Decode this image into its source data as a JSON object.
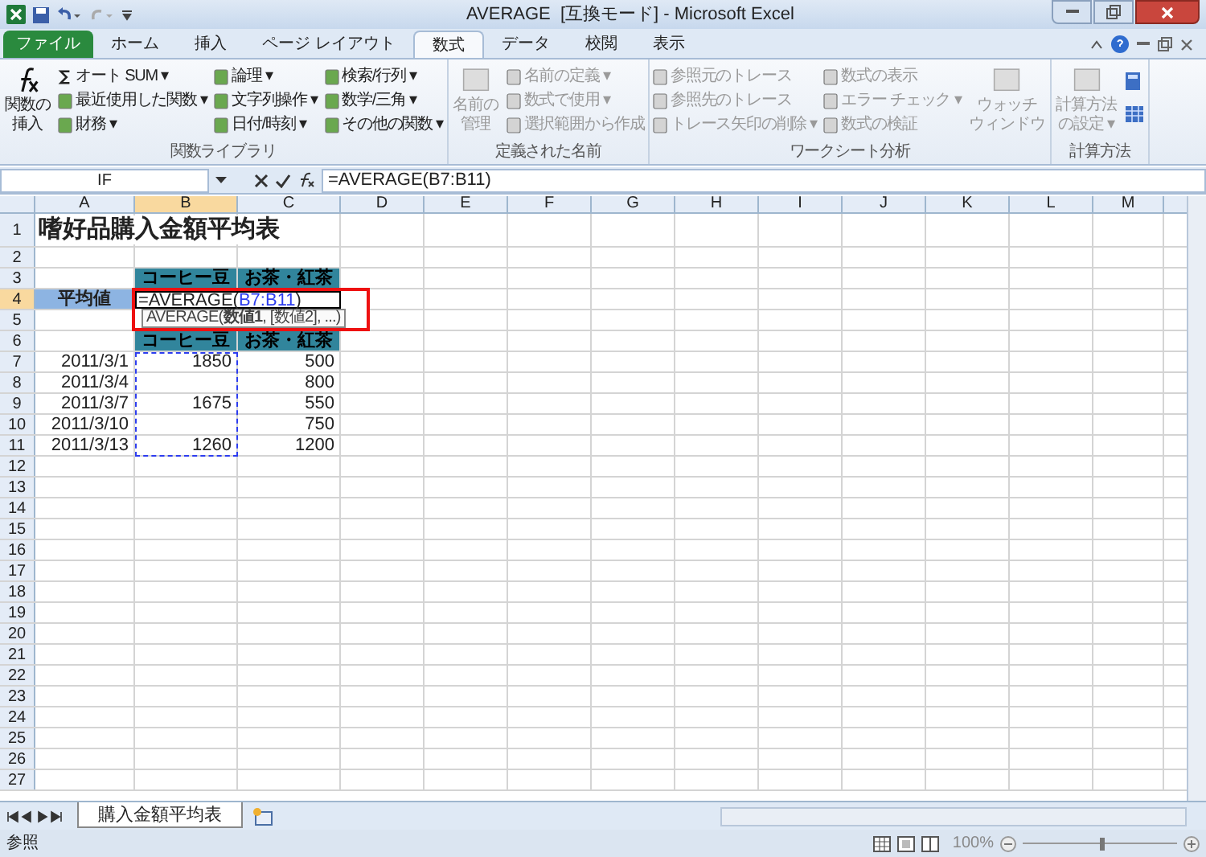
{
  "window": {
    "title": "AVERAGE  [互換モード] - Microsoft Excel"
  },
  "tabs": [
    {
      "label": "ファイル",
      "selected": false,
      "kind": "file"
    },
    {
      "label": "ホーム",
      "selected": false,
      "kind": "tab"
    },
    {
      "label": "挿入",
      "selected": false,
      "kind": "tab"
    },
    {
      "label": "ページ レイアウト",
      "selected": false,
      "kind": "tab"
    },
    {
      "label": "数式",
      "selected": true,
      "kind": "tab"
    },
    {
      "label": "データ",
      "selected": false,
      "kind": "tab"
    },
    {
      "label": "校閲",
      "selected": false,
      "kind": "tab"
    },
    {
      "label": "表示",
      "selected": false,
      "kind": "tab"
    }
  ],
  "ribbon": [
    {
      "label": "関数ライブラリ",
      "columns": [
        [
          {
            "lines": [
              "関数の",
              "挿入"
            ],
            "kind": "large",
            "disabled": false
          }
        ],
        [
          {
            "label": "オート SUM ▾",
            "kind": "sigma",
            "disabled": false
          },
          {
            "label": "最近使用した関数 ▾",
            "kind": "small",
            "disabled": false
          },
          {
            "label": "財務 ▾",
            "kind": "small",
            "disabled": false
          }
        ],
        [
          {
            "label": "論理 ▾",
            "kind": "small",
            "disabled": false
          },
          {
            "label": "文字列操作 ▾",
            "kind": "small",
            "disabled": false
          },
          {
            "label": "日付/時刻 ▾",
            "kind": "small",
            "disabled": false
          }
        ],
        [
          {
            "label": "検索/行列 ▾",
            "kind": "small",
            "disabled": false
          },
          {
            "label": "数学/三角 ▾",
            "kind": "small",
            "disabled": false
          },
          {
            "label": "その他の関数 ▾",
            "kind": "small",
            "disabled": false
          }
        ]
      ]
    },
    {
      "label": "定義された名前",
      "columns": [
        [
          {
            "lines": [
              "名前の",
              "管理"
            ],
            "kind": "large",
            "disabled": true
          }
        ],
        [
          {
            "label": "名前の定義 ▾",
            "kind": "small",
            "disabled": true
          },
          {
            "label": "数式で使用 ▾",
            "kind": "small",
            "disabled": true
          },
          {
            "label": "選択範囲から作成",
            "kind": "small",
            "disabled": true
          }
        ]
      ]
    },
    {
      "label": "ワークシート分析",
      "columns": [
        [
          {
            "label": "参照元のトレース",
            "kind": "small",
            "disabled": true
          },
          {
            "label": "参照先のトレース",
            "kind": "small",
            "disabled": true
          },
          {
            "label": "トレース矢印の削除 ▾",
            "kind": "small",
            "disabled": true
          }
        ],
        [
          {
            "label": "数式の表示",
            "kind": "small",
            "disabled": true
          },
          {
            "label": "エラー チェック ▾",
            "kind": "small",
            "disabled": true
          },
          {
            "label": "数式の検証",
            "kind": "small",
            "disabled": true
          }
        ],
        [
          {
            "lines": [
              "ウォッチ",
              "ウィンドウ"
            ],
            "kind": "large",
            "disabled": true
          }
        ]
      ]
    },
    {
      "label": "計算方法",
      "columns": [
        [
          {
            "lines": [
              "計算方法",
              "の設定 ▾"
            ],
            "kind": "large",
            "disabled": true
          }
        ],
        [
          {
            "kind": "iconpair"
          }
        ]
      ]
    }
  ],
  "formula_bar": {
    "name_box": "IF",
    "formula": "=AVERAGE(B7:B11)"
  },
  "columns": [
    {
      "label": "A",
      "selected": false
    },
    {
      "label": "B",
      "selected": true
    },
    {
      "label": "C",
      "selected": false
    },
    {
      "label": "D",
      "selected": false
    },
    {
      "label": "E",
      "selected": false
    },
    {
      "label": "F",
      "selected": false
    },
    {
      "label": "G",
      "selected": false
    },
    {
      "label": "H",
      "selected": false
    },
    {
      "label": "I",
      "selected": false
    },
    {
      "label": "J",
      "selected": false
    },
    {
      "label": "K",
      "selected": false
    },
    {
      "label": "L",
      "selected": false
    },
    {
      "label": "M",
      "selected": false
    }
  ],
  "rows": [
    {
      "header": "1",
      "selected": false,
      "cells": {
        "A": {
          "text": "嗜好品購入金額平均表",
          "kind": "title"
        }
      }
    },
    {
      "header": "2",
      "selected": false
    },
    {
      "header": "3",
      "selected": false,
      "cells": {
        "B": {
          "text": "コーヒー豆",
          "kind": "head"
        },
        "C": {
          "text": "お茶・紅茶",
          "kind": "head"
        }
      }
    },
    {
      "header": "4",
      "selected": true,
      "cells": {
        "A": {
          "text": "平均値",
          "kind": "label"
        }
      }
    },
    {
      "header": "5",
      "selected": false
    },
    {
      "header": "6",
      "selected": false,
      "cells": {
        "B": {
          "text": "コーヒー豆",
          "kind": "head"
        },
        "C": {
          "text": "お茶・紅茶",
          "kind": "head"
        }
      }
    },
    {
      "header": "7",
      "selected": false,
      "cells": {
        "A": {
          "text": "2011/3/1",
          "kind": "num"
        },
        "B": {
          "text": "1850",
          "kind": "num"
        },
        "C": {
          "text": "500",
          "kind": "num"
        }
      }
    },
    {
      "header": "8",
      "selected": false,
      "cells": {
        "A": {
          "text": "2011/3/4",
          "kind": "num"
        },
        "C": {
          "text": "800",
          "kind": "num"
        }
      }
    },
    {
      "header": "9",
      "selected": false,
      "cells": {
        "A": {
          "text": "2011/3/7",
          "kind": "num"
        },
        "B": {
          "text": "1675",
          "kind": "num"
        },
        "C": {
          "text": "550",
          "kind": "num"
        }
      }
    },
    {
      "header": "10",
      "selected": false,
      "cells": {
        "A": {
          "text": "2011/3/10",
          "kind": "num"
        },
        "C": {
          "text": "750",
          "kind": "num"
        }
      }
    },
    {
      "header": "11",
      "selected": false,
      "cells": {
        "A": {
          "text": "2011/3/13",
          "kind": "num"
        },
        "B": {
          "text": "1260",
          "kind": "num"
        },
        "C": {
          "text": "1200",
          "kind": "num"
        }
      }
    },
    {
      "header": "12",
      "selected": false
    },
    {
      "header": "13",
      "selected": false
    },
    {
      "header": "14",
      "selected": false
    },
    {
      "header": "15",
      "selected": false
    },
    {
      "header": "16",
      "selected": false
    },
    {
      "header": "17",
      "selected": false
    },
    {
      "header": "18",
      "selected": false
    },
    {
      "header": "19",
      "selected": false
    },
    {
      "header": "20",
      "selected": false
    },
    {
      "header": "21",
      "selected": false
    },
    {
      "header": "22",
      "selected": false
    },
    {
      "header": "23",
      "selected": false
    },
    {
      "header": "24",
      "selected": false
    },
    {
      "header": "25",
      "selected": false
    },
    {
      "header": "26",
      "selected": false
    },
    {
      "header": "27",
      "selected": false
    }
  ],
  "edit_cell": {
    "prefix": "=AVERAGE(",
    "reference": "B7:B11",
    "suffix": ")"
  },
  "tooltip": "AVERAGE(**数値1**, [数値2], ...)",
  "sheet_tabs": [
    {
      "label": "購入金額平均表",
      "selected": true
    }
  ],
  "status_bar": {
    "mode": "参照",
    "zoom": "100%",
    "level": 0.5
  }
}
